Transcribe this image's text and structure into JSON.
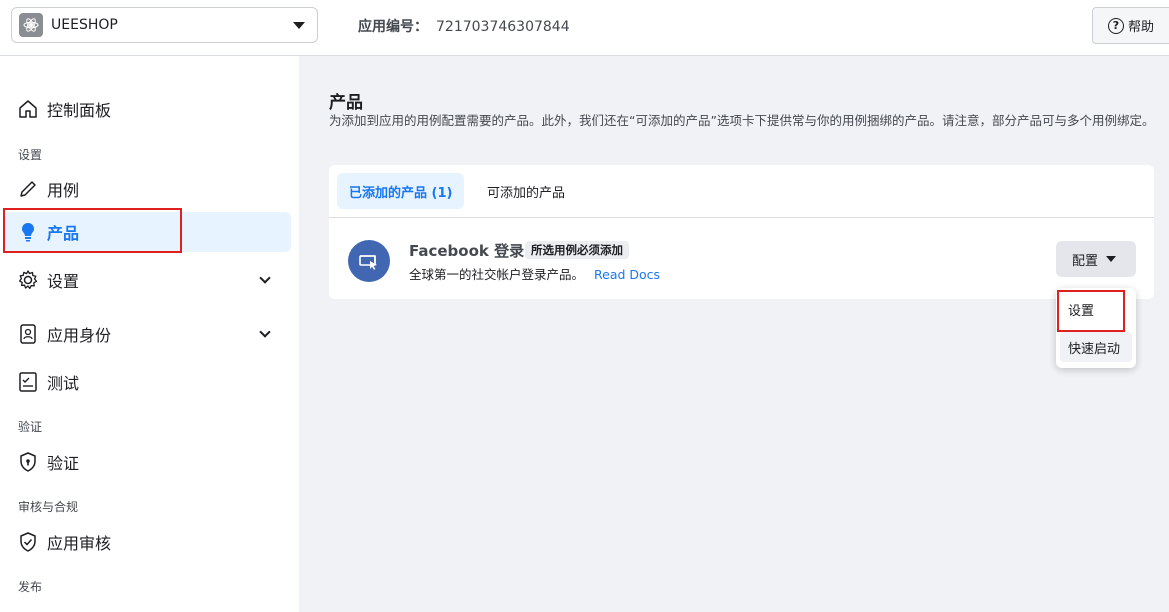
{
  "topbar": {
    "app_name": "UEESHOP",
    "app_id_label": "应用编号：",
    "app_id_value": "721703746307844",
    "help_label": "帮助"
  },
  "sidebar": {
    "dashboard": "控制面板",
    "section_settings": "设置",
    "use_cases": "用例",
    "products": "产品",
    "settings": "设置",
    "app_roles": "应用身份",
    "testing": "测试",
    "section_verification": "验证",
    "verification": "验证",
    "section_review": "审核与合规",
    "app_review": "应用审核",
    "section_publish": "发布"
  },
  "main": {
    "title": "产品",
    "description": "为添加到应用的用例配置需要的产品。此外，我们还在“可添加的产品”选项卡下提供常与你的用例捆绑的产品。请注意，部分产品可与多个用例绑定。",
    "tabs": [
      {
        "label": "已添加的产品 (1)"
      },
      {
        "label": "可添加的产品"
      }
    ],
    "product": {
      "name": "Facebook 登录",
      "badge": "所选用例必须添加",
      "description": "全球第一的社交帐户登录产品。",
      "link": "Read Docs",
      "config_label": "配置"
    },
    "dropdown": {
      "items": [
        "设置",
        "快速启动"
      ]
    }
  },
  "colors": {
    "accent": "#1877f2",
    "highlight_red": "#e02020",
    "product_icon_bg": "#4267b2"
  }
}
